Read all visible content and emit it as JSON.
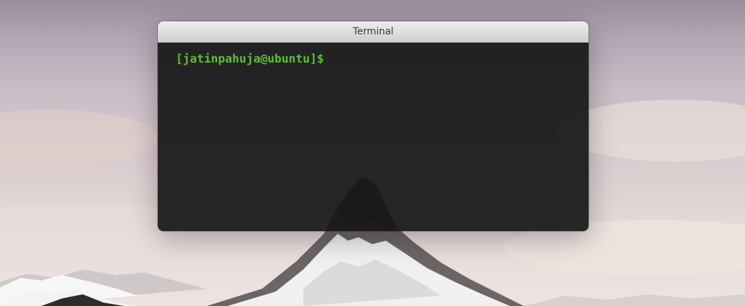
{
  "desktop": {
    "wallpaper": "matterhorn-mountain-wallpaper"
  },
  "window": {
    "title": "Terminal"
  },
  "terminal": {
    "prompt": "[jatinpahuja@ubuntu]$",
    "input": "",
    "prompt_color": "#57c034",
    "background_color": "#181818"
  }
}
